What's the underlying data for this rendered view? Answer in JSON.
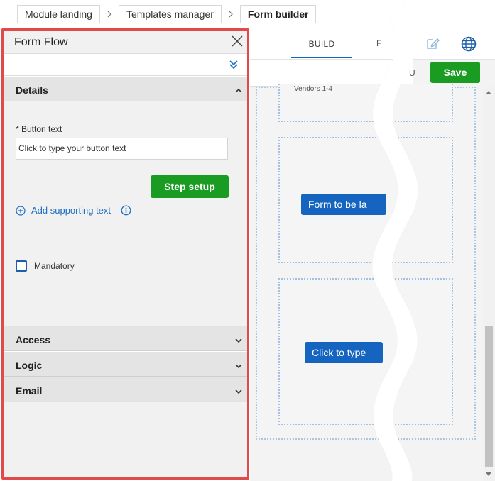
{
  "breadcrumb": {
    "items": [
      "Module landing",
      "Templates manager",
      "Form builder"
    ]
  },
  "builder": {
    "tab_build": "BUILD",
    "tab_cut": "F",
    "toolbar_cut": "U",
    "save_label": "Save",
    "vendors_label": "Vendors 1-4",
    "form_button_1": "Form to be la",
    "form_button_2": "Click to type"
  },
  "panel": {
    "title": "Form Flow",
    "sections": {
      "details": "Details",
      "access": "Access",
      "logic": "Logic",
      "email": "Email"
    },
    "button_text_label": "* Button text",
    "button_text_value": "Click to type your button text",
    "step_setup_label": "Step setup",
    "add_supporting_text": "Add supporting text",
    "mandatory_label": "Mandatory"
  },
  "colors": {
    "accent_green": "#1a9c22",
    "accent_blue": "#1565c0",
    "highlight_border": "#e24949"
  }
}
